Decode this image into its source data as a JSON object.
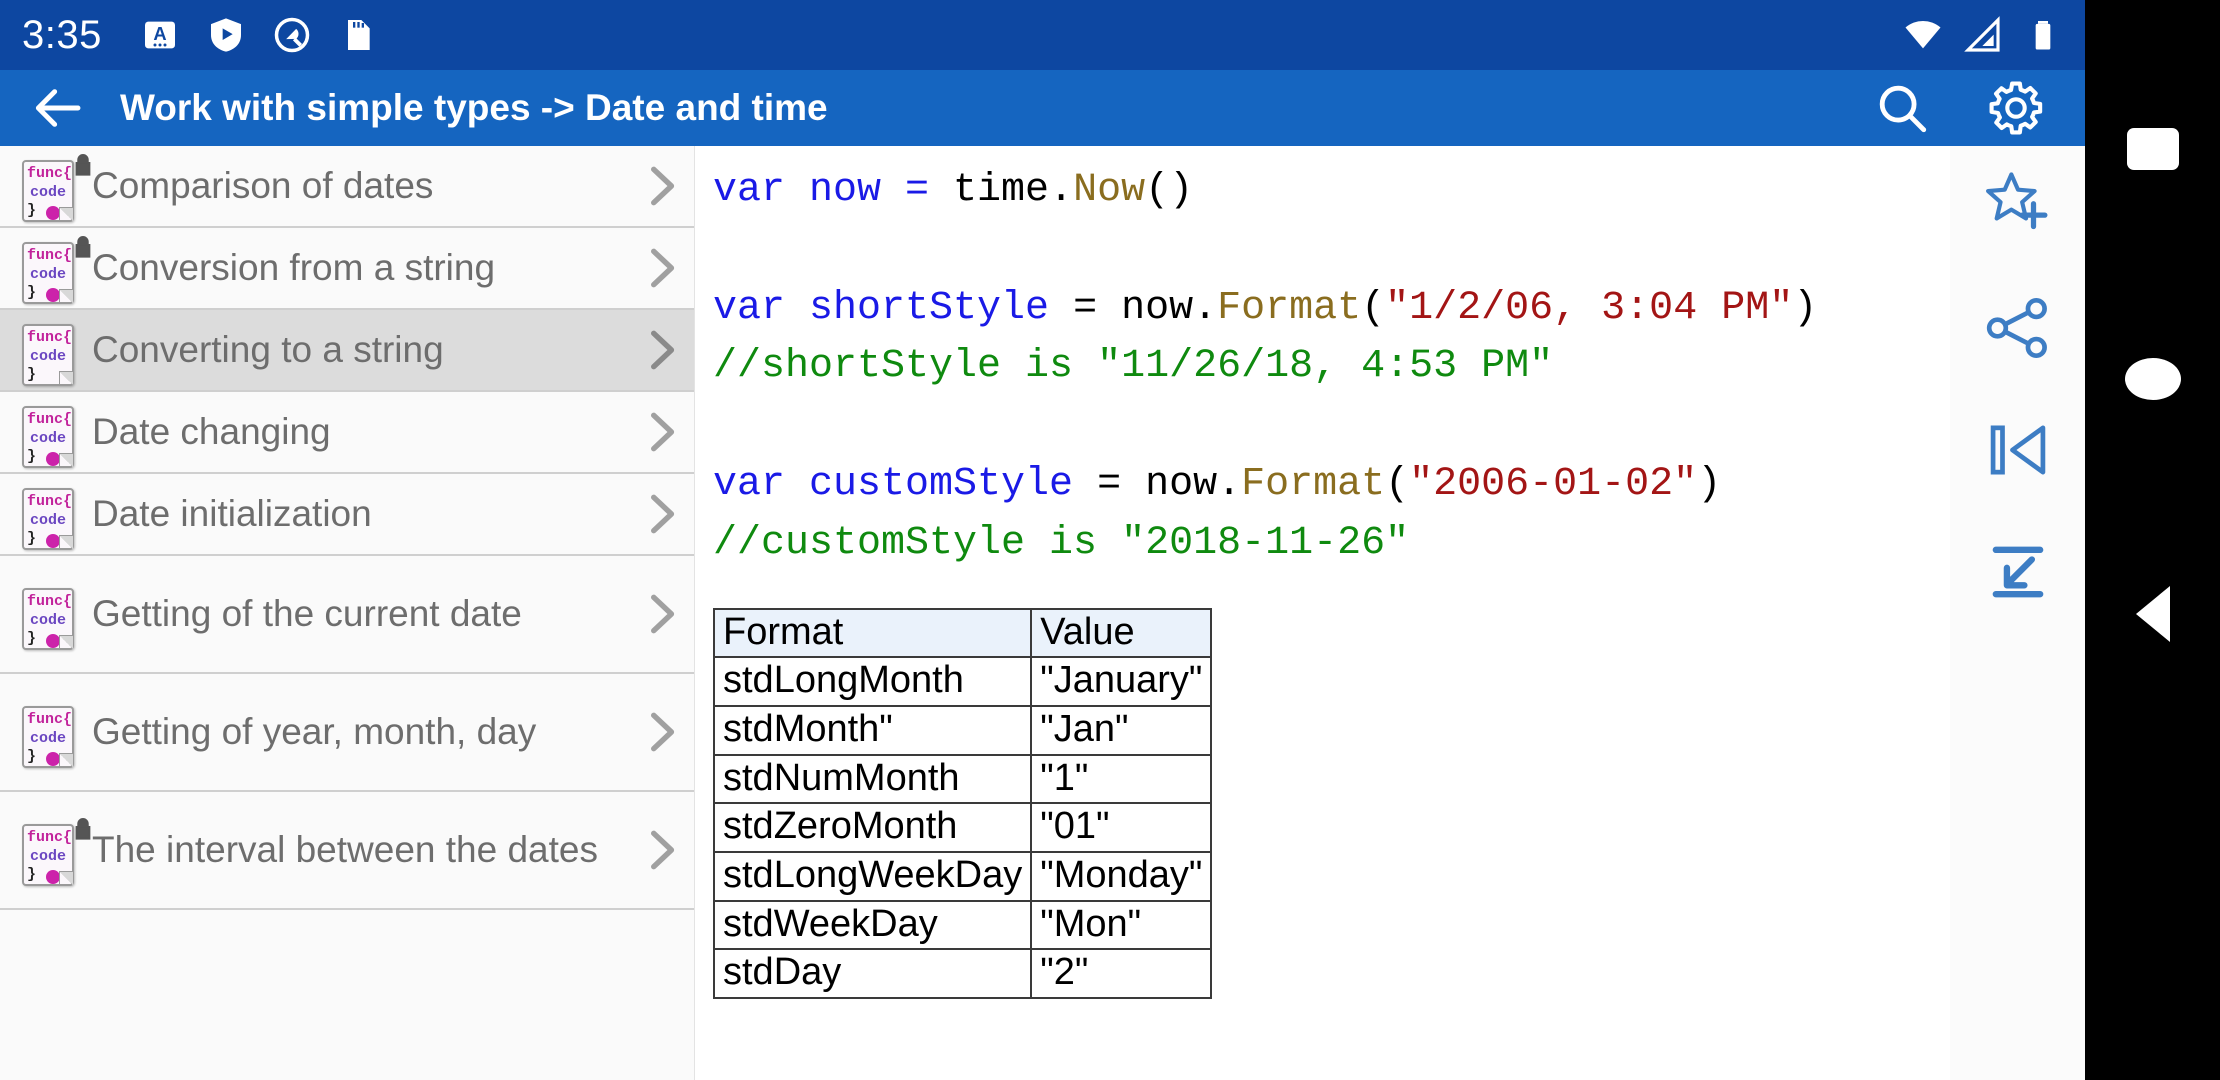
{
  "statusbar": {
    "clock": "3:35",
    "left_icons": [
      "keyboard-language-icon",
      "play-protect-shield-icon",
      "circle-q-icon",
      "sd-card-icon"
    ],
    "right_icons": [
      "wifi-icon",
      "cell-signal-icon",
      "battery-icon"
    ]
  },
  "appbar": {
    "back_label": "back-arrow",
    "title": "Work with simple types -> Date and time",
    "search_label": "search-icon",
    "settings_label": "gear-icon"
  },
  "sidebar": {
    "items": [
      {
        "label": "Comparison of dates",
        "locked": true,
        "selected": false,
        "dot": true
      },
      {
        "label": "Conversion from a string",
        "locked": true,
        "selected": false,
        "dot": true
      },
      {
        "label": "Converting to a string",
        "locked": false,
        "selected": true,
        "dot": false
      },
      {
        "label": "Date changing",
        "locked": false,
        "selected": false,
        "dot": true
      },
      {
        "label": "Date initialization",
        "locked": false,
        "selected": false,
        "dot": true
      },
      {
        "label": "Getting of the current date",
        "locked": false,
        "selected": false,
        "dot": true
      },
      {
        "label": "Getting of year, month, day",
        "locked": false,
        "selected": false,
        "dot": true
      },
      {
        "label": "The interval between the dates",
        "locked": true,
        "selected": false,
        "dot": true
      }
    ]
  },
  "content": {
    "code_lines": [
      [
        {
          "t": "var",
          "c": "kw"
        },
        {
          "t": " now = ",
          "c": "id"
        },
        {
          "t": "time.",
          "c": "pl"
        },
        {
          "t": "Now",
          "c": "fn"
        },
        {
          "t": "()",
          "c": "pl"
        }
      ],
      [
        {
          "t": "",
          "c": "pl"
        }
      ],
      [
        {
          "t": "var",
          "c": "kw"
        },
        {
          "t": " shortStyle",
          "c": "id"
        },
        {
          "t": " = ",
          "c": "pl"
        },
        {
          "t": "now.",
          "c": "pl"
        },
        {
          "t": "Format",
          "c": "fn"
        },
        {
          "t": "(",
          "c": "pl"
        },
        {
          "t": "\"1/2/06, 3:04 PM\"",
          "c": "str"
        },
        {
          "t": ")",
          "c": "pl"
        }
      ],
      [
        {
          "t": "//shortStyle is \"11/26/18, 4:53 PM\"",
          "c": "cmt"
        }
      ],
      [
        {
          "t": "",
          "c": "pl"
        }
      ],
      [
        {
          "t": "var",
          "c": "kw"
        },
        {
          "t": " customStyle",
          "c": "id"
        },
        {
          "t": " = ",
          "c": "pl"
        },
        {
          "t": "now.",
          "c": "pl"
        },
        {
          "t": "Format",
          "c": "fn"
        },
        {
          "t": "(",
          "c": "pl"
        },
        {
          "t": "\"2006-01-02\"",
          "c": "str"
        },
        {
          "t": ")",
          "c": "pl"
        }
      ],
      [
        {
          "t": "//customStyle is \"2018-11-26\"",
          "c": "cmt"
        }
      ]
    ],
    "table": {
      "headers": [
        "Format",
        "Value"
      ],
      "rows": [
        [
          "stdLongMonth",
          "\"January\""
        ],
        [
          "stdMonth\"",
          "\"Jan\""
        ],
        [
          "stdNumMonth",
          "\"1\""
        ],
        [
          "stdZeroMonth",
          "\"01\""
        ],
        [
          "stdLongWeekDay",
          "\"Monday\""
        ],
        [
          "stdWeekDay",
          "\"Mon\""
        ],
        [
          "stdDay",
          "\"2\""
        ]
      ]
    }
  },
  "toolrail": {
    "items": [
      "add-to-favorites-icon",
      "share-icon",
      "skip-to-start-icon",
      "collapse-fit-icon"
    ]
  },
  "navbar": {
    "items": [
      "recents-button",
      "home-button",
      "back-button"
    ]
  },
  "colors": {
    "statusbar": "#0d47a1",
    "appbar": "#1565c0",
    "accent": "#3d7dc4",
    "selected_row": "#dcdcdc",
    "table_header": "#eaf2fb"
  }
}
